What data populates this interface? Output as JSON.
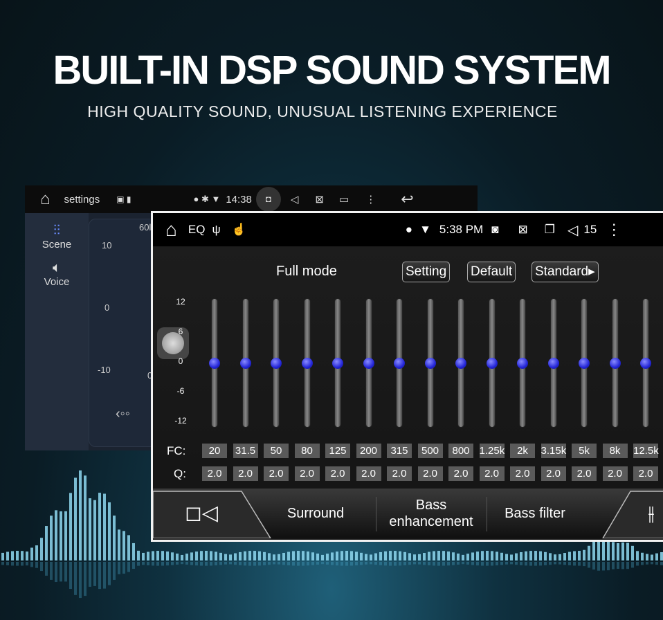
{
  "headline": "BUILT-IN DSP SOUND SYSTEM",
  "subheadline": "HIGH QUALITY SOUND, UNUSUAL LISTENING EXPERIENCE",
  "back_screen": {
    "app_title": "settings",
    "time": "14:38",
    "sidebar": [
      {
        "label": "Scene",
        "icon": "equalizer-icon"
      },
      {
        "label": "Voice",
        "icon": "speaker-icon"
      }
    ],
    "scale": [
      "10",
      "0",
      "-10"
    ],
    "freq_partial": "60l",
    "zero_partial": "0"
  },
  "front_screen": {
    "app_title": "EQ",
    "time": "5:38 PM",
    "volume": "15",
    "mode": "Full mode",
    "buttons": {
      "setting": "Setting",
      "default": "Default",
      "standard": "Standard▸"
    },
    "scale": [
      "12",
      "6",
      "0",
      "-6",
      "-12"
    ],
    "fc_label": "FC:",
    "q_label": "Q:",
    "bands": [
      {
        "fc": "20",
        "q": "2.0",
        "gain": 0
      },
      {
        "fc": "31.5",
        "q": "2.0",
        "gain": 0
      },
      {
        "fc": "50",
        "q": "2.0",
        "gain": 0
      },
      {
        "fc": "80",
        "q": "2.0",
        "gain": 0
      },
      {
        "fc": "125",
        "q": "2.0",
        "gain": 0
      },
      {
        "fc": "200",
        "q": "2.0",
        "gain": 0
      },
      {
        "fc": "315",
        "q": "2.0",
        "gain": 0
      },
      {
        "fc": "500",
        "q": "2.0",
        "gain": 0
      },
      {
        "fc": "800",
        "q": "2.0",
        "gain": 0
      },
      {
        "fc": "1.25k",
        "q": "2.0",
        "gain": 0
      },
      {
        "fc": "2k",
        "q": "2.0",
        "gain": 0
      },
      {
        "fc": "3.15k",
        "q": "2.0",
        "gain": 0
      },
      {
        "fc": "5k",
        "q": "2.0",
        "gain": 0
      },
      {
        "fc": "8k",
        "q": "2.0",
        "gain": 0
      },
      {
        "fc": "12.5k",
        "q": "2.0",
        "gain": 0
      }
    ],
    "tabs": {
      "surround": "Surround",
      "bass_enh_1": "Bass",
      "bass_enh_2": "enhancement",
      "bass_filter": "Bass filter"
    },
    "knob_color": "#2426d8"
  }
}
